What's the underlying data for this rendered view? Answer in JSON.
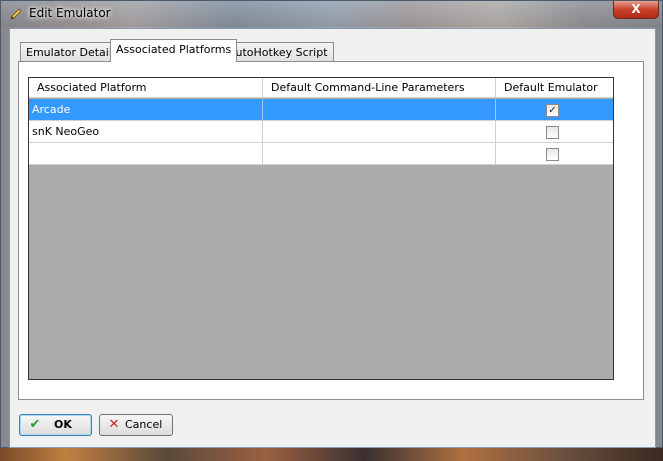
{
  "window": {
    "title": "Edit Emulator",
    "close_symbol": "X",
    "title_icon": "pencil-icon"
  },
  "tabs": [
    {
      "label": "Emulator Details",
      "active": false
    },
    {
      "label": "Associated Platforms",
      "active": true
    },
    {
      "label": "AutoHotkey Script",
      "active": false
    }
  ],
  "grid": {
    "columns": [
      "Associated Platform",
      "Default Command-Line Parameters",
      "Default Emulator"
    ],
    "rows": [
      {
        "platform": "Arcade",
        "params": "",
        "default": true,
        "selected": true
      },
      {
        "platform": "snK NeoGeo",
        "params": "",
        "default": false,
        "selected": false
      },
      {
        "platform": "",
        "params": "",
        "default": false,
        "selected": false
      }
    ]
  },
  "buttons": {
    "ok": {
      "label": "OK",
      "icon": "check-icon",
      "icon_color": "#2a9a2a"
    },
    "cancel": {
      "label": "Cancel",
      "icon": "x-icon",
      "icon_color": "#cc2222"
    }
  },
  "colors": {
    "selection": "#3399ff",
    "grid_background": "#ababab"
  }
}
